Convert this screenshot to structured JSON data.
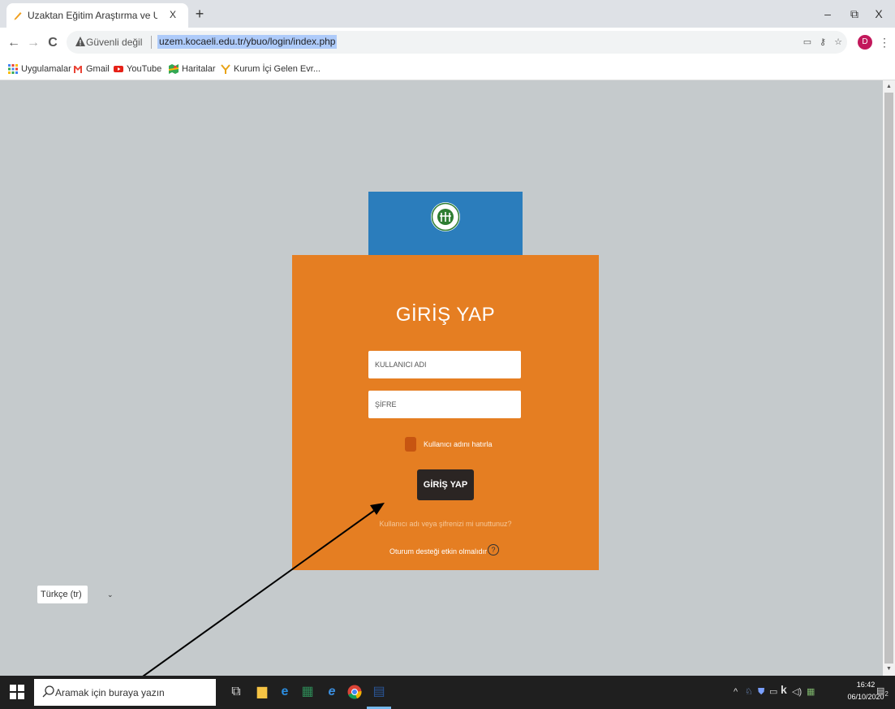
{
  "browser": {
    "tab_title": "Uzaktan Eğitim Araştırma ve Uyg",
    "tab_close": "X",
    "new_tab": "+",
    "window_controls": {
      "minimize": "–",
      "maximize": "⧉",
      "close": "X"
    },
    "nav": {
      "back": "←",
      "forward": "→",
      "reload": "C"
    },
    "security_text": "Güvenli değil",
    "url": "uzem.kocaeli.edu.tr/ybuo/login/index.php",
    "profile_initial": "D",
    "bookmarks": [
      {
        "label": "Uygulamalar",
        "icon": "apps-grid-icon"
      },
      {
        "label": "Gmail",
        "icon": "gmail-icon"
      },
      {
        "label": "YouTube",
        "icon": "youtube-icon"
      },
      {
        "label": "Haritalar",
        "icon": "maps-icon"
      },
      {
        "label": "Kurum İçi Gelen Evr...",
        "icon": "yandex-icon"
      }
    ]
  },
  "login": {
    "title": "GİRİŞ YAP",
    "username_placeholder": "KULLANICI ADI",
    "password_placeholder": "ŞİFRE",
    "remember_label": "Kullanıcı adını hatırla",
    "submit_label": "GİRİŞ YAP",
    "forgot_link": "Kullanıcı adı veya şifrenizi mi unuttunuz?",
    "session_note": "Oturum desteği etkin olmalıdır",
    "help_glyph": "?"
  },
  "language_select": {
    "selected": "Türkçe (tr)"
  },
  "taskbar": {
    "search_placeholder": "Aramak için buraya yazın",
    "time": "16:42",
    "date": "06/10/2020",
    "notification_count": "2"
  },
  "colors": {
    "page_bg": "#c5cacc",
    "header_blue": "#2b7dbc",
    "form_orange": "#e57e22",
    "button_dark": "#2b2523"
  }
}
